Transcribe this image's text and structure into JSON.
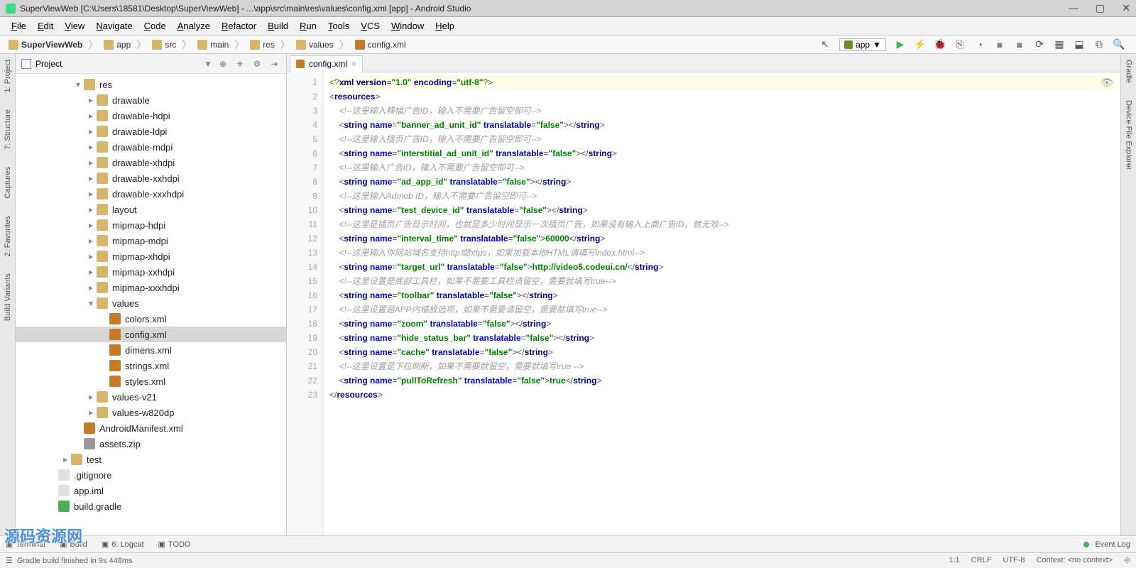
{
  "window": {
    "title": "SuperViewWeb [C:\\Users\\18581\\Desktop\\SuperViewWeb] - ...\\app\\src\\main\\res\\values\\config.xml [app] - Android Studio"
  },
  "menus": [
    "File",
    "Edit",
    "View",
    "Navigate",
    "Code",
    "Analyze",
    "Refactor",
    "Build",
    "Run",
    "Tools",
    "VCS",
    "Window",
    "Help"
  ],
  "breadcrumb": [
    {
      "label": "SuperViewWeb",
      "icon": "folder"
    },
    {
      "label": "app",
      "icon": "folder"
    },
    {
      "label": "src",
      "icon": "folder"
    },
    {
      "label": "main",
      "icon": "folder"
    },
    {
      "label": "res",
      "icon": "folder"
    },
    {
      "label": "values",
      "icon": "folder"
    },
    {
      "label": "config.xml",
      "icon": "xml"
    }
  ],
  "run_config": "app",
  "project_panel": {
    "title": "Project"
  },
  "tree": [
    {
      "indent": 4,
      "arrow": "▾",
      "icon": "folder",
      "label": "res"
    },
    {
      "indent": 5,
      "arrow": "▸",
      "icon": "folder",
      "label": "drawable"
    },
    {
      "indent": 5,
      "arrow": "▸",
      "icon": "folder",
      "label": "drawable-hdpi"
    },
    {
      "indent": 5,
      "arrow": "▸",
      "icon": "folder",
      "label": "drawable-ldpi"
    },
    {
      "indent": 5,
      "arrow": "▸",
      "icon": "folder",
      "label": "drawable-mdpi"
    },
    {
      "indent": 5,
      "arrow": "▸",
      "icon": "folder",
      "label": "drawable-xhdpi"
    },
    {
      "indent": 5,
      "arrow": "▸",
      "icon": "folder",
      "label": "drawable-xxhdpi"
    },
    {
      "indent": 5,
      "arrow": "▸",
      "icon": "folder",
      "label": "drawable-xxxhdpi"
    },
    {
      "indent": 5,
      "arrow": "▸",
      "icon": "folder",
      "label": "layout"
    },
    {
      "indent": 5,
      "arrow": "▸",
      "icon": "folder",
      "label": "mipmap-hdpi"
    },
    {
      "indent": 5,
      "arrow": "▸",
      "icon": "folder",
      "label": "mipmap-mdpi"
    },
    {
      "indent": 5,
      "arrow": "▸",
      "icon": "folder",
      "label": "mipmap-xhdpi"
    },
    {
      "indent": 5,
      "arrow": "▸",
      "icon": "folder",
      "label": "mipmap-xxhdpi"
    },
    {
      "indent": 5,
      "arrow": "▸",
      "icon": "folder",
      "label": "mipmap-xxxhdpi"
    },
    {
      "indent": 5,
      "arrow": "▾",
      "icon": "folder",
      "label": "values"
    },
    {
      "indent": 6,
      "arrow": "",
      "icon": "xmlf",
      "label": "colors.xml"
    },
    {
      "indent": 6,
      "arrow": "",
      "icon": "xmlf",
      "label": "config.xml",
      "selected": true
    },
    {
      "indent": 6,
      "arrow": "",
      "icon": "xmlf",
      "label": "dimens.xml"
    },
    {
      "indent": 6,
      "arrow": "",
      "icon": "xmlf",
      "label": "strings.xml"
    },
    {
      "indent": 6,
      "arrow": "",
      "icon": "xmlf",
      "label": "styles.xml"
    },
    {
      "indent": 5,
      "arrow": "▸",
      "icon": "folder",
      "label": "values-v21"
    },
    {
      "indent": 5,
      "arrow": "▸",
      "icon": "folder",
      "label": "values-w820dp"
    },
    {
      "indent": 4,
      "arrow": "",
      "icon": "xmlf",
      "label": "AndroidManifest.xml"
    },
    {
      "indent": 4,
      "arrow": "",
      "icon": "zip",
      "label": "assets.zip"
    },
    {
      "indent": 3,
      "arrow": "▸",
      "icon": "folder",
      "label": "test"
    },
    {
      "indent": 2,
      "arrow": "",
      "icon": "file",
      "label": ".gitignore"
    },
    {
      "indent": 2,
      "arrow": "",
      "icon": "file",
      "label": "app.iml"
    },
    {
      "indent": 2,
      "arrow": "",
      "icon": "gradle",
      "label": "build.gradle"
    }
  ],
  "editor_tab": {
    "label": "config.xml"
  },
  "code_lines": [
    {
      "n": 1,
      "html": "<span class='line1'>&lt;?<span class='t'>xml version</span>=<span class='v'>\"1.0\"</span> <span class='t'>encoding</span>=<span class='v'>\"utf-8\"</span>?&gt;</span>"
    },
    {
      "n": 2,
      "html": "&lt;<span class='t'>resources</span>&gt;"
    },
    {
      "n": 3,
      "html": "    <span class='c'>&lt;!--这里输入横幅广告ID，输入不需要广告留空即可--&gt;</span>"
    },
    {
      "n": 4,
      "html": "    &lt;<span class='t'>string</span> <span class='a'>name</span>=<span class='v'>\"banner_ad_unit_id\"</span> <span class='a'>translatable</span>=<span class='v'>\"false\"</span>&gt;&lt;/<span class='t'>string</span>&gt;"
    },
    {
      "n": 5,
      "html": "    <span class='c'>&lt;!--这里输入插页广告ID，输入不需要广告留空即可--&gt;</span>"
    },
    {
      "n": 6,
      "html": "    &lt;<span class='t'>string</span> <span class='a'>name</span>=<span class='v'>\"interstitial_ad_unit_id\"</span> <span class='a'>translatable</span>=<span class='v'>\"false\"</span>&gt;&lt;/<span class='t'>string</span>&gt;"
    },
    {
      "n": 7,
      "html": "    <span class='c'>&lt;!--这里输入广告ID，输入不需要广告留空即可--&gt;</span>"
    },
    {
      "n": 8,
      "html": "    &lt;<span class='t'>string</span> <span class='a'>name</span>=<span class='v'>\"ad_app_id\"</span> <span class='a'>translatable</span>=<span class='v'>\"false\"</span>&gt;&lt;/<span class='t'>string</span>&gt;"
    },
    {
      "n": 9,
      "html": "    <span class='c'>&lt;!--这里输入Admob ID，输入不需要广告留空即可--&gt;</span>"
    },
    {
      "n": 10,
      "html": "    &lt;<span class='t'>string</span> <span class='a'>name</span>=<span class='v'>\"test_device_id\"</span> <span class='a'>translatable</span>=<span class='v'>\"false\"</span>&gt;&lt;/<span class='t'>string</span>&gt;"
    },
    {
      "n": 11,
      "html": "    <span class='c'>&lt;!--这里是插页广告显示时间，也就是多少时间显示一次插页广告，如果没有输入上面广告ID，就无效--&gt;</span>"
    },
    {
      "n": 12,
      "html": "    &lt;<span class='t'>string</span> <span class='a'>name</span>=<span class='v'>\"interval_time\"</span> <span class='a'>translatable</span>=<span class='v'>\"false\"</span>&gt;<span class='txt'>60000</span>&lt;/<span class='t'>string</span>&gt;"
    },
    {
      "n": 13,
      "html": "    <span class='c'>&lt;!--这里输入你网站域名支持http或https，如果加载本地HTML请填写index.html--&gt;</span>"
    },
    {
      "n": 14,
      "html": "    &lt;<span class='t'>string</span> <span class='a'>name</span>=<span class='v'>\"target_url\"</span> <span class='a'>translatable</span>=<span class='v'>\"false\"</span>&gt;<span class='txt'>http://video5.codeui.cn/</span>&lt;/<span class='t'>string</span>&gt;"
    },
    {
      "n": 15,
      "html": "    <span class='c'>&lt;!--这里设置是底部工具栏，如果不需要工具栏请留空，需要就填写true--&gt;</span>"
    },
    {
      "n": 16,
      "html": "    &lt;<span class='t'>string</span> <span class='a'>name</span>=<span class='v'>\"toolbar\"</span> <span class='a'>translatable</span>=<span class='v'>\"false\"</span>&gt;&lt;/<span class='t'>string</span>&gt;"
    },
    {
      "n": 17,
      "html": "    <span class='c'>&lt;!--这里设置是APP内缩放选项，如果不需要请留空，需要就填写true--&gt;</span>"
    },
    {
      "n": 18,
      "html": "    &lt;<span class='t'>string</span> <span class='a'>name</span>=<span class='v'>\"zoom\"</span> <span class='a'>translatable</span>=<span class='v'>\"false\"</span>&gt;&lt;/<span class='t'>string</span>&gt;"
    },
    {
      "n": 19,
      "html": "    &lt;<span class='t'>string</span> <span class='a'>name</span>=<span class='v'>\"hide_status_bar\"</span> <span class='a'>translatable</span>=<span class='v'>\"false\"</span>&gt;&lt;/<span class='t'>string</span>&gt;"
    },
    {
      "n": 20,
      "html": "    &lt;<span class='t'>string</span> <span class='a'>name</span>=<span class='v'>\"cache\"</span> <span class='a'>translatable</span>=<span class='v'>\"false\"</span>&gt;&lt;/<span class='t'>string</span>&gt;"
    },
    {
      "n": 21,
      "html": "    <span class='c'>&lt;!--这里设置是下拉刷新，如果不需要就留空，需要就填写true --&gt;</span>"
    },
    {
      "n": 22,
      "html": "    &lt;<span class='t'>string</span> <span class='a'>name</span>=<span class='v'>\"pullToRefresh\"</span> <span class='a'>translatable</span>=<span class='v'>\"false\"</span>&gt;<span class='txt'>true</span>&lt;/<span class='t'>string</span>&gt;"
    },
    {
      "n": 23,
      "html": "&lt;/<span class='t'>resources</span>&gt;"
    }
  ],
  "left_tools": [
    "1: Project",
    "7: Structure",
    "Captures"
  ],
  "left_tools_lower": [
    "2: Favorites",
    "Build Variants"
  ],
  "right_tools": [
    "Gradle",
    "Device File Explorer"
  ],
  "bottom_tabs": [
    {
      "label": "Terminal"
    },
    {
      "label": "Build"
    },
    {
      "label": "6: Logcat"
    },
    {
      "label": "TODO"
    }
  ],
  "event_log": "Event Log",
  "status": {
    "message": "Gradle build finished in 9s 448ms",
    "line_col": "1:1",
    "crlf": "CRLF",
    "encoding": "UTF-8",
    "context": "Context: <no context>"
  },
  "watermark": "源码资源网"
}
